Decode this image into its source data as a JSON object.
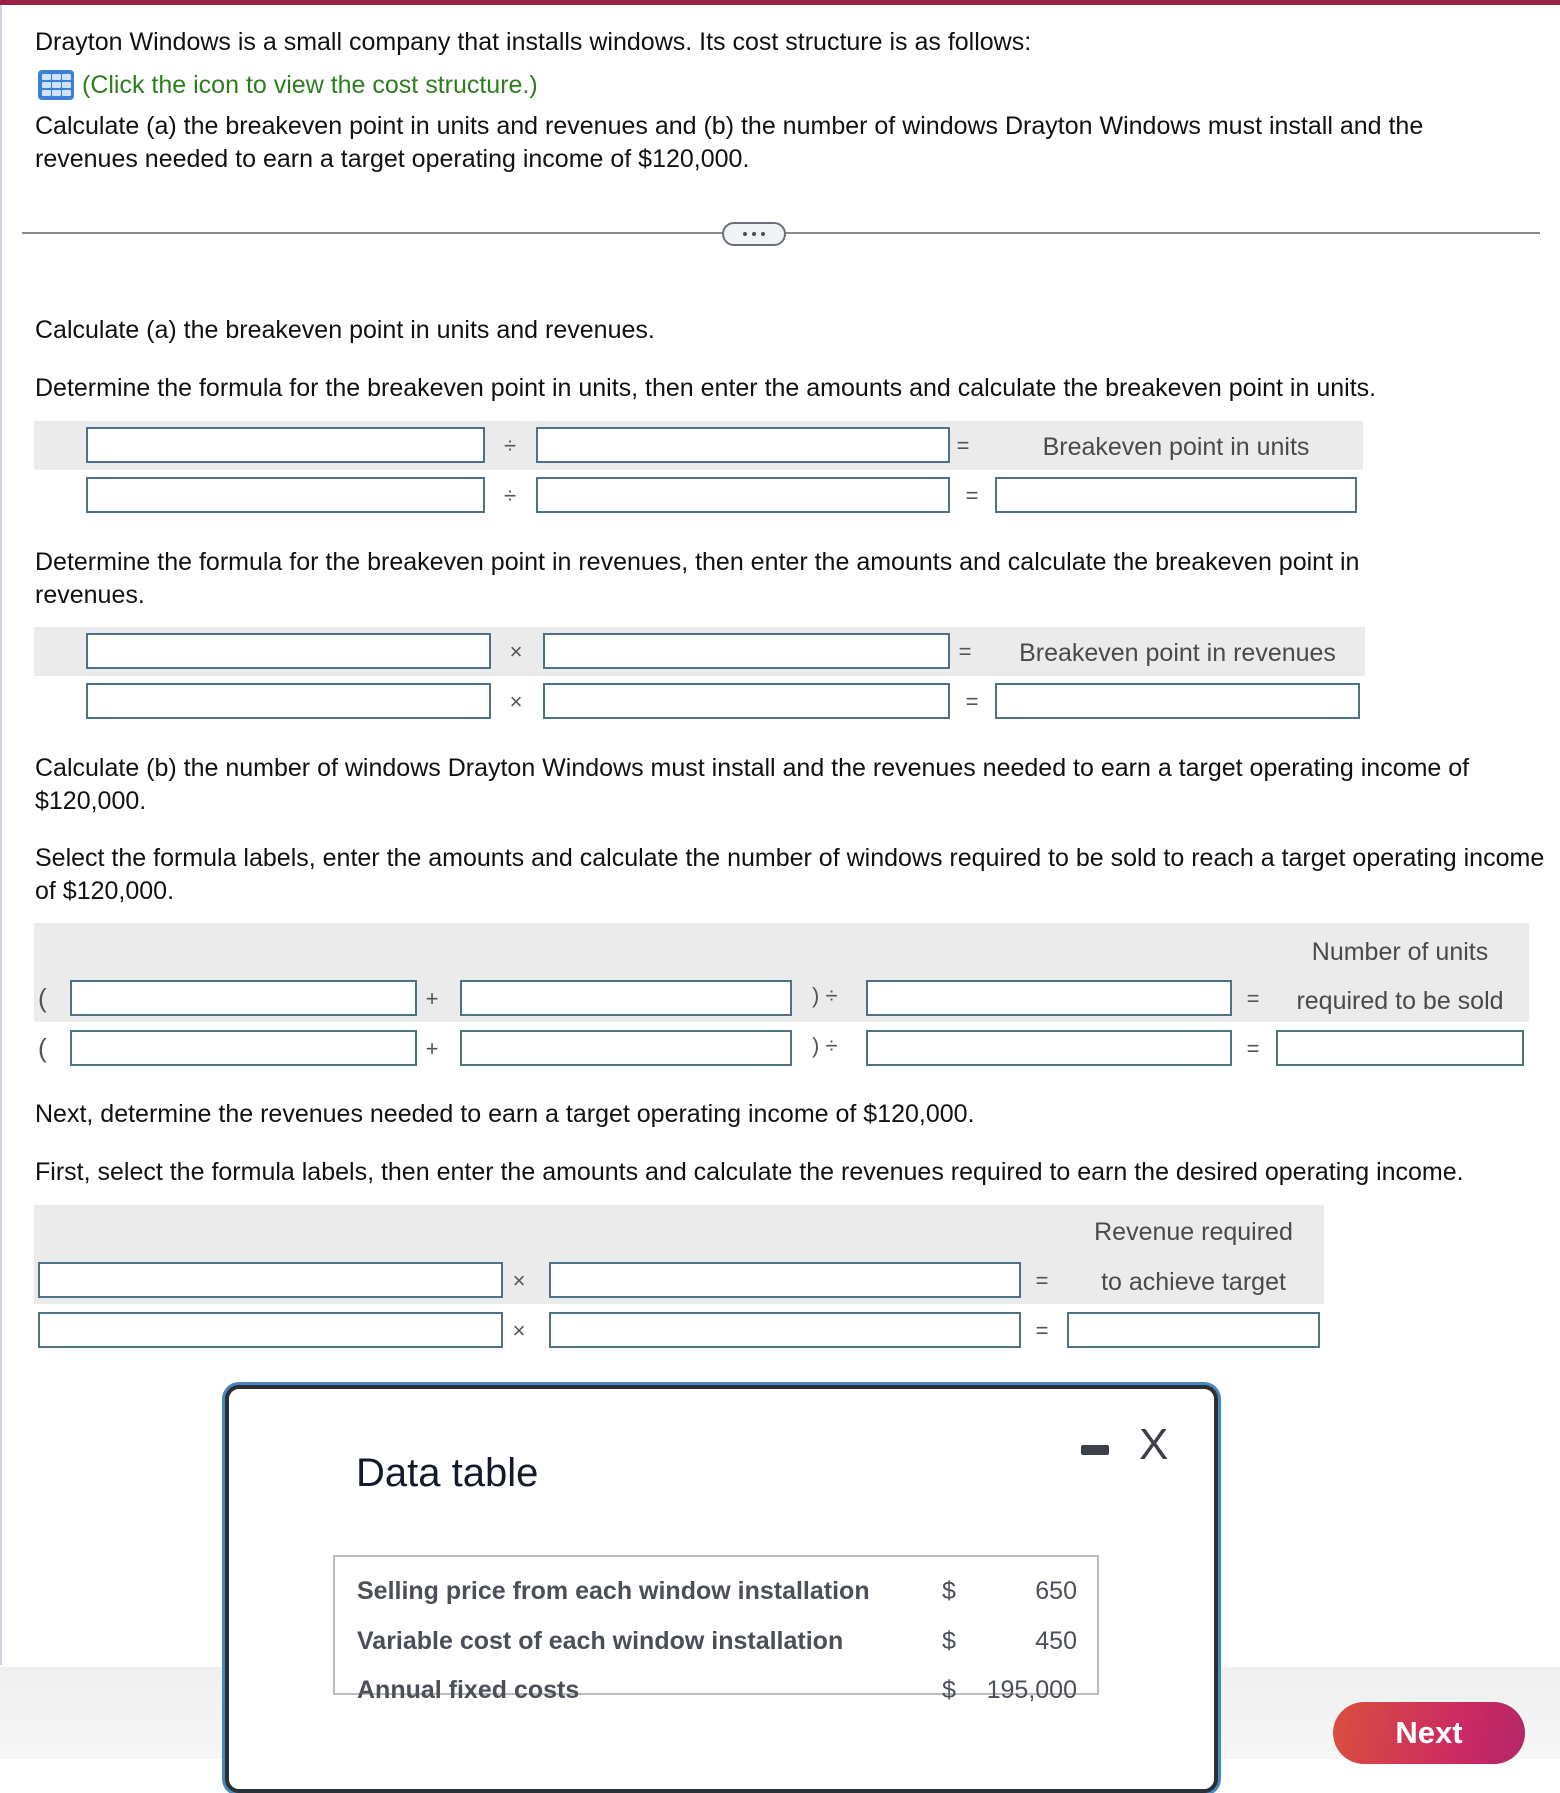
{
  "header": {
    "intro": "Drayton Windows is a small company that installs windows. Its cost structure is as follows:",
    "cost_link": "(Click the icon to view the cost structure.)",
    "task": "Calculate (a) the breakeven point in units and revenues and (b) the number of windows Drayton Windows must install and the revenues needed to earn a target operating income of $120,000."
  },
  "divider": {
    "expand_label": "..."
  },
  "part_a": {
    "heading": "Calculate (a) the breakeven point in units and revenues.",
    "units": {
      "instruction": "Determine the formula for the breakeven point in units, then enter the amounts and calculate the breakeven point in units.",
      "operator": "÷",
      "equals": "=",
      "result_label": "Breakeven point in units",
      "inputs": {
        "label_1": "",
        "label_2": "",
        "amount_1": "",
        "amount_2": "",
        "result": ""
      }
    },
    "revenues": {
      "instruction": "Determine the formula for the breakeven point in revenues, then enter the amounts and calculate the breakeven point in revenues.",
      "operator": "×",
      "equals": "=",
      "result_label": "Breakeven point in revenues",
      "inputs": {
        "label_1": "",
        "label_2": "",
        "amount_1": "",
        "amount_2": "",
        "result": ""
      }
    }
  },
  "part_b": {
    "heading": "Calculate (b) the number of windows Drayton Windows must install and the revenues needed to earn a target operating income of $120,000.",
    "units": {
      "instruction": "Select the formula labels, enter the amounts and calculate the number of windows required to be sold to reach a target operating income of $120,000.",
      "open_paren": "(",
      "plus": "+",
      "close_div": ") ÷",
      "equals": "=",
      "result_label_line1": "Number of units",
      "result_label_line2": "required to be sold"
    },
    "revenues": {
      "intro": "Next, determine the revenues needed to earn a target operating income of $120,000.",
      "instruction": "First, select the formula labels, then enter the amounts and calculate the revenues required to earn the desired operating income.",
      "operator": "×",
      "equals": "=",
      "result_label_line1": "Revenue required",
      "result_label_line2": "to achieve target"
    }
  },
  "modal": {
    "title": "Data table",
    "minimize_label": "minimize",
    "close_label": "X",
    "rows": [
      {
        "label": "Selling price from each window installation",
        "currency": "$",
        "value": "650"
      },
      {
        "label": "Variable cost of each window installation",
        "currency": "$",
        "value": "450"
      },
      {
        "label": "Annual fixed costs",
        "currency": "$",
        "value": "195,000"
      }
    ]
  },
  "footer": {
    "next_label": "Next"
  },
  "colors": {
    "brand_bar": "#9b2246",
    "link_text": "#2e7d1f",
    "input_border": "#4d7185",
    "next_start": "#d9503e",
    "next_end": "#b42668"
  }
}
